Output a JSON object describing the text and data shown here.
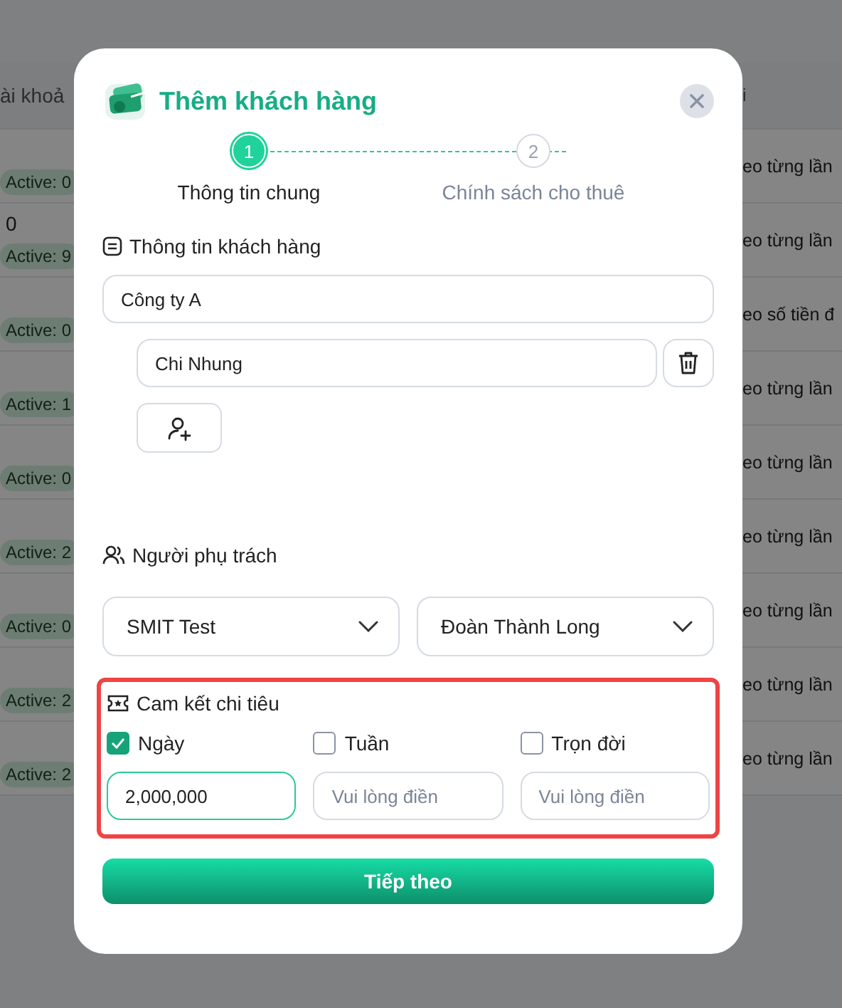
{
  "background_table": {
    "columns": [
      "ài khoả",
      "i"
    ],
    "rows": [
      {
        "badge": "Active: 0",
        "policy": "eo từng lần"
      },
      {
        "count": "0",
        "badge": "Active: 9",
        "policy": "eo từng lần"
      },
      {
        "badge": "Active: 0",
        "policy": "eo số tiền đ"
      },
      {
        "badge": "Active: 1",
        "policy": "eo từng lần"
      },
      {
        "badge": "Active: 0",
        "policy": "eo từng lần"
      },
      {
        "badge": "Active: 2",
        "policy": "eo từng lần"
      },
      {
        "badge": "Active: 0",
        "policy": "eo từng lần"
      },
      {
        "badge": "Active: 2",
        "policy": "eo từng lần"
      },
      {
        "badge": "Active: 2",
        "policy": "eo từng lần"
      }
    ]
  },
  "dialog": {
    "title": "Thêm khách hàng",
    "steps": [
      {
        "number": "1",
        "label": "Thông tin chung",
        "selected": true
      },
      {
        "number": "2",
        "label": "Chính sách cho thuê",
        "selected": false
      }
    ],
    "customer_section": {
      "title": "Thông tin khách hàng",
      "company": {
        "value": "Công ty A"
      },
      "contacts": [
        {
          "value": "Chi Nhung"
        }
      ]
    },
    "manager_section": {
      "title": "Người phụ trách",
      "selects": [
        {
          "value": "SMIT Test"
        },
        {
          "value": "Đoàn Thành Long"
        }
      ]
    },
    "commitment": {
      "title": "Cam kết chi tiêu",
      "highlighted": true,
      "options": [
        {
          "label": "Ngày",
          "checked": true,
          "value": "2,000,000",
          "focused": true
        },
        {
          "label": "Tuần",
          "checked": false,
          "placeholder": "Vui lòng điền",
          "focused": false
        },
        {
          "label": "Trọn đời",
          "checked": false,
          "placeholder": "Vui lòng điền",
          "focused": false
        }
      ]
    },
    "next_button": "Tiếp theo"
  }
}
